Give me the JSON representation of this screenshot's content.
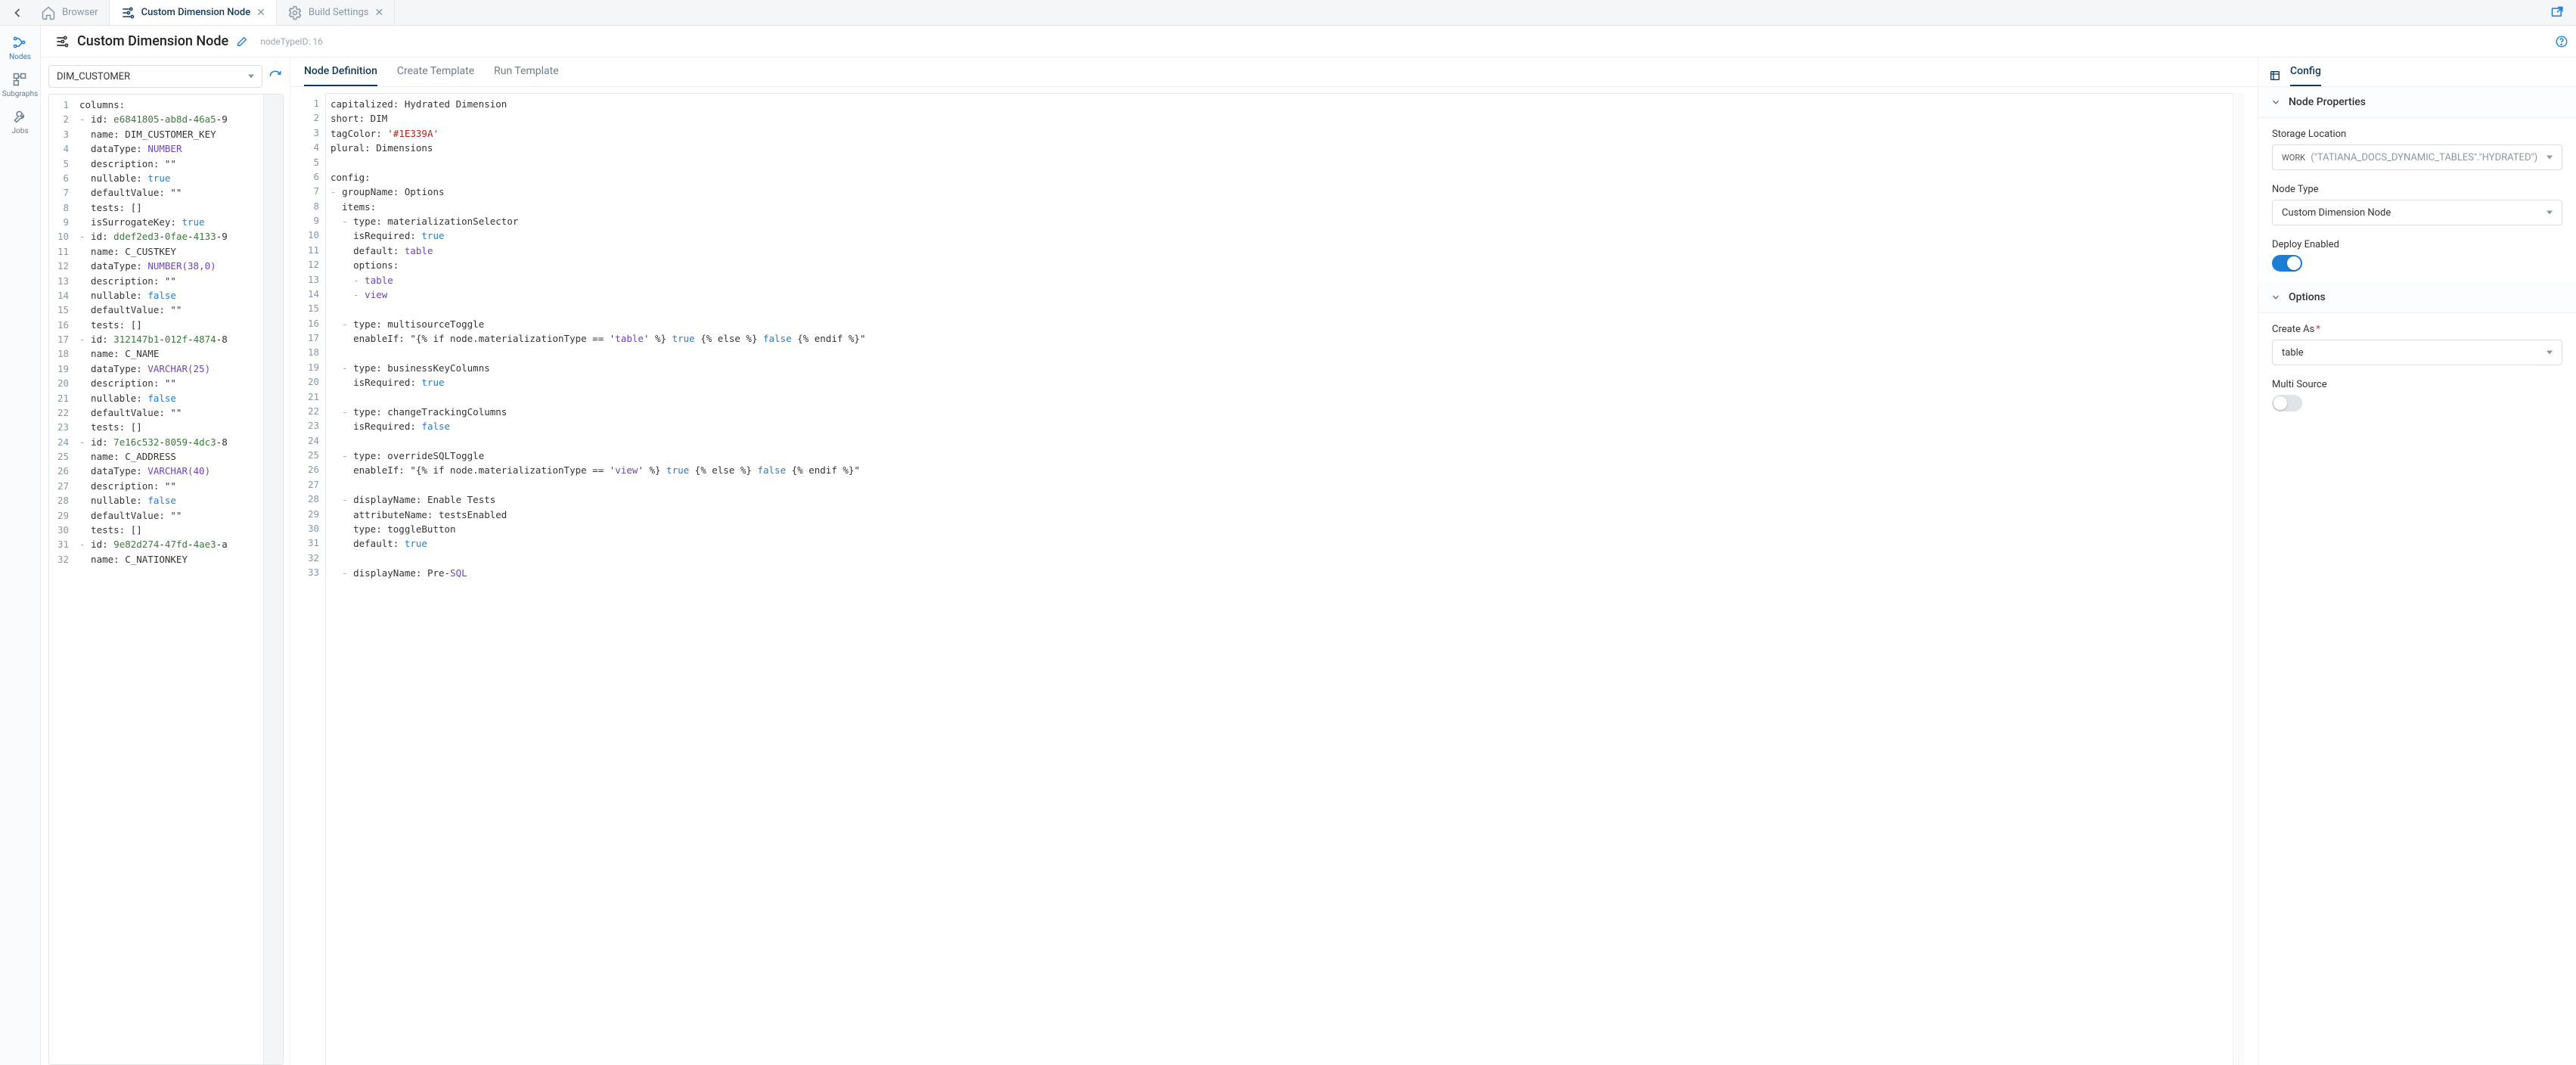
{
  "topbar": {
    "tabs": [
      {
        "icon": "home-icon",
        "label": "Browser",
        "active": false,
        "closable": false
      },
      {
        "icon": "sliders-icon",
        "label": "Custom Dimension Node",
        "active": true,
        "closable": true
      },
      {
        "icon": "gear-icon",
        "label": "Build Settings",
        "active": false,
        "closable": true
      }
    ]
  },
  "sidebar": {
    "items": [
      {
        "label": "Nodes",
        "icon": "nodes-icon",
        "active": true
      },
      {
        "label": "Subgraphs",
        "icon": "subgraph-icon",
        "active": false
      },
      {
        "label": "Jobs",
        "icon": "wrench-icon",
        "active": false
      }
    ]
  },
  "pageHeader": {
    "title": "Custom Dimension Node",
    "meta_label": "nodeTypeID:",
    "meta_value": "16"
  },
  "leftSelector": {
    "value": "DIM_CUSTOMER"
  },
  "leftEditor": {
    "lines": [
      "columns:",
      "- id: e6841805-ab8d-46a5-9",
      "  name: DIM_CUSTOMER_KEY",
      "  dataType: NUMBER",
      "  description: \"\"",
      "  nullable: true",
      "  defaultValue: \"\"",
      "  tests: []",
      "  isSurrogateKey: true",
      "- id: ddef2ed3-0fae-4133-9",
      "  name: C_CUSTKEY",
      "  dataType: NUMBER(38,0)",
      "  description: \"\"",
      "  nullable: false",
      "  defaultValue: \"\"",
      "  tests: []",
      "- id: 312147b1-012f-4874-8",
      "  name: C_NAME",
      "  dataType: VARCHAR(25)",
      "  description: \"\"",
      "  nullable: false",
      "  defaultValue: \"\"",
      "  tests: []",
      "- id: 7e16c532-8059-4dc3-8",
      "  name: C_ADDRESS",
      "  dataType: VARCHAR(40)",
      "  description: \"\"",
      "  nullable: false",
      "  defaultValue: \"\"",
      "  tests: []",
      "- id: 9e82d274-47fd-4ae3-a",
      "  name: C_NATIONKEY"
    ]
  },
  "midTabs": [
    "Node Definition",
    "Create Template",
    "Run Template"
  ],
  "midTabs_activeIndex": 0,
  "midEditor": {
    "lines": [
      "capitalized: Hydrated Dimension",
      "short: DIM",
      "tagColor: '#1E339A'",
      "plural: Dimensions",
      "",
      "config:",
      "- groupName: Options",
      "  items:",
      "  - type: materializationSelector",
      "    isRequired: true",
      "    default: table",
      "    options:",
      "    - table",
      "    - view",
      "",
      "  - type: multisourceToggle",
      "    enableIf: \"{% if node.materializationType == 'table' %} true {% else %} false {% endif %}\"",
      "",
      "  - type: businessKeyColumns",
      "    isRequired: true",
      "",
      "  - type: changeTrackingColumns",
      "    isRequired: false",
      "",
      "  - type: overrideSQLToggle",
      "    enableIf: \"{% if node.materializationType == 'view' %} true {% else %} false {% endif %}\"",
      "",
      "  - displayName: Enable Tests",
      "    attributeName: testsEnabled",
      "    type: toggleButton",
      "    default: true",
      "",
      "  - displayName: Pre-SQL"
    ]
  },
  "rightTabs": {
    "label": "Config"
  },
  "nodeProperties": {
    "section_title": "Node Properties",
    "storage_label": "Storage Location",
    "storage_prefix": "WORK",
    "storage_path": "(\"TATIANA_DOCS_DYNAMIC_TABLES\".\"HYDRATED\")",
    "nodeType_label": "Node Type",
    "nodeType_value": "Custom Dimension Node",
    "deploy_label": "Deploy Enabled",
    "deploy_value": true
  },
  "options": {
    "section_title": "Options",
    "createAs_label": "Create As",
    "createAs_value": "table",
    "multiSource_label": "Multi Source",
    "multiSource_value": false
  },
  "chart_data": null
}
